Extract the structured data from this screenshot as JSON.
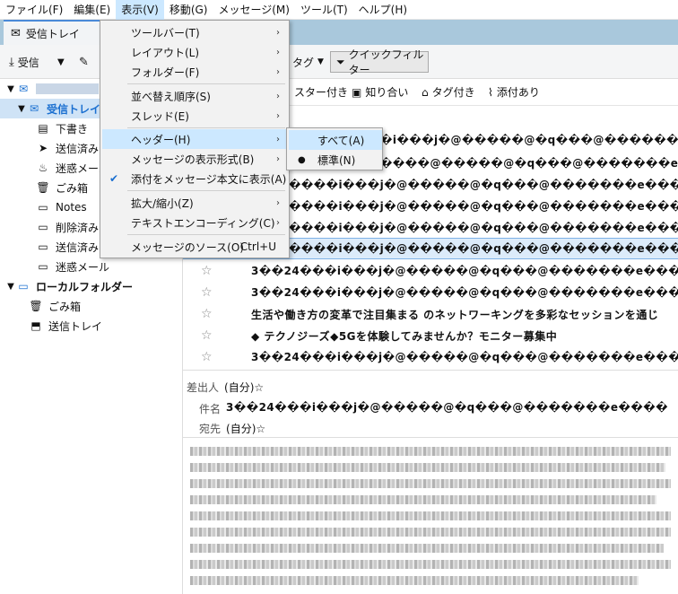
{
  "menubar": {
    "items": [
      "ファイル(F)",
      "編集(E)",
      "表示(V)",
      "移動(G)",
      "メッセージ(M)",
      "ツール(T)",
      "ヘルプ(H)"
    ]
  },
  "tabs": {
    "inbox": "受信トレイ"
  },
  "toolbar": {
    "get_messages": "受信",
    "tag": "タグ",
    "quick_filter": "クイックフィルター"
  },
  "filterbar": {
    "starred": "スター付き",
    "contacts": "知り合い",
    "tagged": "タグ付き",
    "attachment": "添付あり"
  },
  "folders": {
    "inbox": "受信トレイ (",
    "drafts": "下書き",
    "sent": "送信済み",
    "junk": "迷惑メール",
    "trash": "ごみ箱",
    "notes": "Notes",
    "deleted": "削除済み",
    "sent2": "送信済み",
    "junk2": "迷惑メール",
    "local": "ローカルフォルダー",
    "local_trash": "ごみ箱",
    "outbox": "送信トレイ"
  },
  "messages": [
    "�i���j�@�����@�q���@�������e�?=",
    "����@�����@�q���@�������e����",
    "����i���j�@�����@�q���@�������e����",
    "����i���j�@�����@�q���@�������e����",
    "����i���j�@�����@�q���@�������e����",
    "����i���j�@�����@�q���@�������e����",
    "3��24���i���j�@�����@�q���@�������e����",
    "3��24���i���j�@�����@�q���@�������e����",
    "生活や働き方の変革で注目集まる          のネットワーキングを多彩なセッションを通じ",
    "◆    テクノジーズ◆5Gを体験してみませんか？モニター募集中",
    "3��24���i���j�@�����@�q���@�������e����"
  ],
  "header": {
    "from_label": "差出人",
    "from_value": "(自分)☆",
    "subject_label": "件名",
    "subject_value": "3��24���i���j�@�����@�q���@�������e����",
    "to_label": "宛先",
    "to_value": "(自分)☆"
  },
  "view_menu": {
    "items": [
      {
        "label": "ツールバー(T)",
        "submenu": true
      },
      {
        "label": "レイアウト(L)",
        "submenu": true
      },
      {
        "label": "フォルダー(F)",
        "submenu": true
      },
      {
        "label": "並べ替え順序(S)",
        "submenu": true
      },
      {
        "label": "スレッド(E)",
        "submenu": true
      },
      {
        "label": "ヘッダー(H)",
        "submenu": true
      },
      {
        "label": "メッセージの表示形式(B)",
        "submenu": true
      },
      {
        "label": "添付をメッセージ本文に表示(A)",
        "checked": true
      },
      {
        "label": "拡大/縮小(Z)",
        "submenu": true
      },
      {
        "label": "テキストエンコーディング(C)",
        "submenu": true
      },
      {
        "label": "メッセージのソース(O)",
        "shortcut": "Ctrl+U"
      }
    ]
  },
  "header_submenu": {
    "items": [
      {
        "label": "すべて(A)"
      },
      {
        "label": "標準(N)",
        "checked": true
      }
    ]
  },
  "colors": {
    "tab_strip": "#a9c8dc",
    "highlight": "#cce8ff",
    "accent": "#1a6fd0"
  }
}
